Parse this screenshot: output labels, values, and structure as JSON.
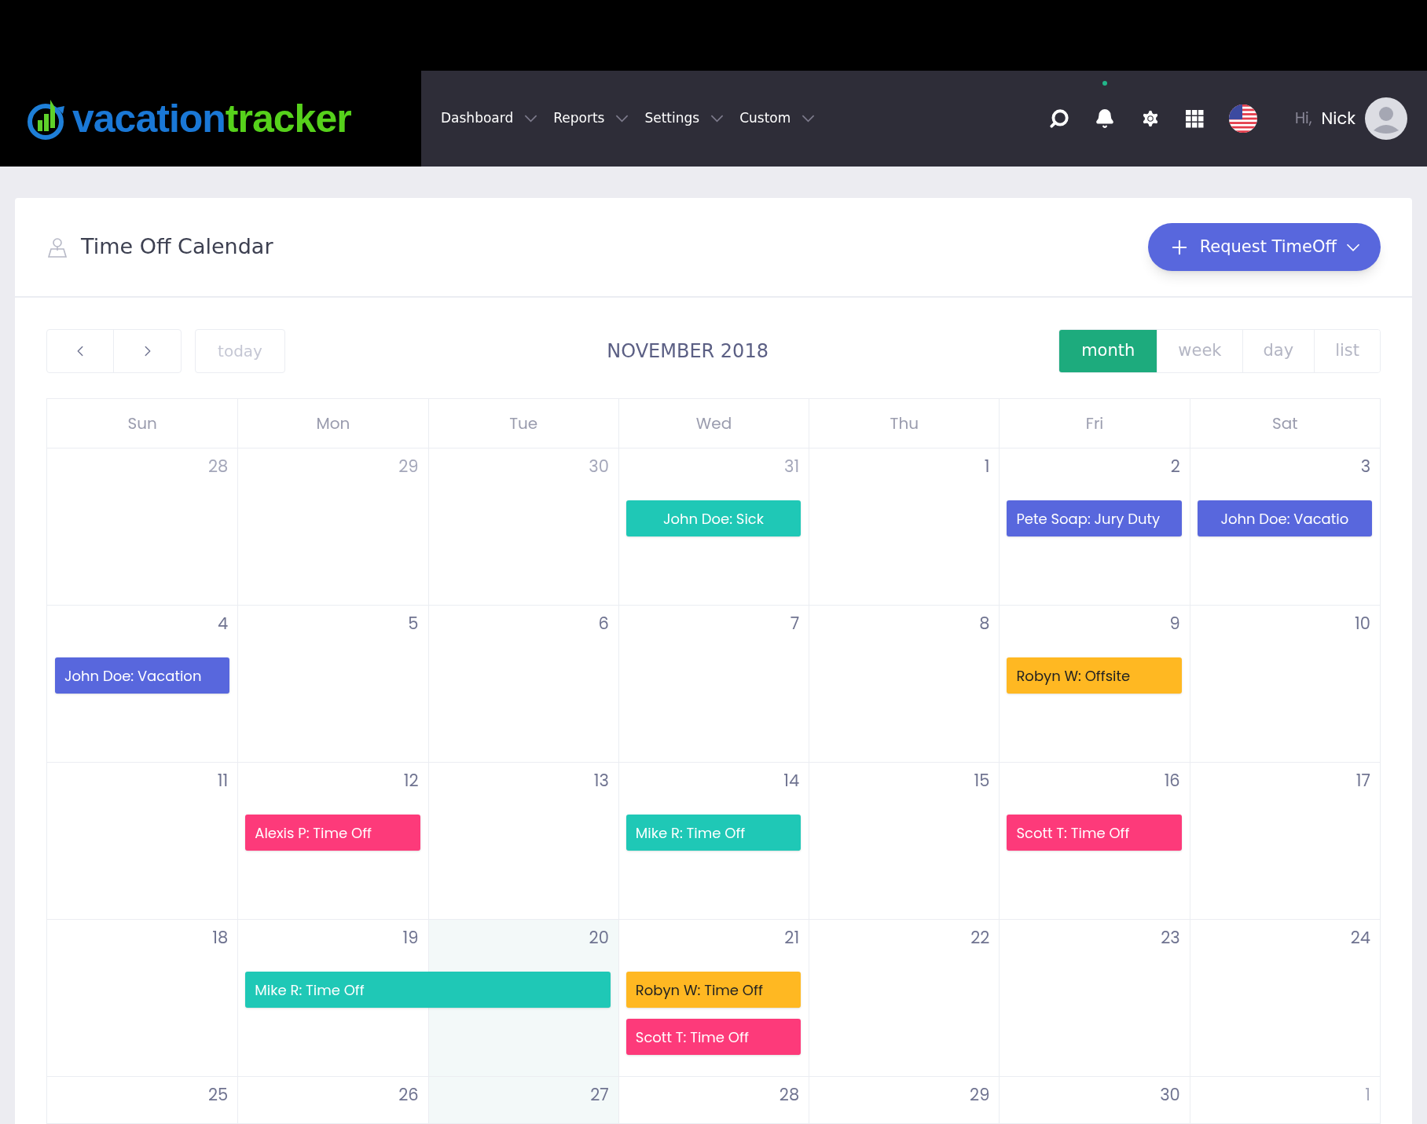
{
  "logo": {
    "parts": [
      "vacation",
      "tracker"
    ]
  },
  "nav": [
    {
      "label": "Dashboard"
    },
    {
      "label": "Reports"
    },
    {
      "label": "Settings"
    },
    {
      "label": "Custom"
    }
  ],
  "notifications": {
    "unread": true
  },
  "user": {
    "greeting": "Hi,",
    "name": "Nick"
  },
  "page": {
    "title": "Time Off Calendar",
    "request_button": "Request TimeOff"
  },
  "toolbar": {
    "today": "today",
    "title": "NOVEMBER 2018",
    "views": [
      {
        "label": "month",
        "selected": true
      },
      {
        "label": "week",
        "selected": false
      },
      {
        "label": "day",
        "selected": false
      },
      {
        "label": "list",
        "selected": false
      }
    ]
  },
  "weekdays": [
    "Sun",
    "Mon",
    "Tue",
    "Wed",
    "Thu",
    "Fri",
    "Sat"
  ],
  "weeks": [
    {
      "days": [
        {
          "date": "28",
          "muted": true
        },
        {
          "date": "29",
          "muted": true
        },
        {
          "date": "30",
          "muted": true
        },
        {
          "date": "31",
          "muted": true,
          "events": [
            {
              "title": "John Doe: Sick",
              "color": "#1fc8b6",
              "centered": true
            }
          ]
        },
        {
          "date": "1",
          "muted": false
        },
        {
          "date": "2",
          "muted": false,
          "events": [
            {
              "title": "Pete Soap: Jury Duty",
              "color": "#5867dd"
            }
          ]
        },
        {
          "date": "3",
          "muted": false,
          "events": [
            {
              "title": "John Doe: Vacatio",
              "color": "#5867dd",
              "centered": true
            }
          ]
        }
      ]
    },
    {
      "days": [
        {
          "date": "4",
          "muted": false,
          "events": [
            {
              "title": "John Doe: Vacation",
              "color": "#5867dd"
            }
          ]
        },
        {
          "date": "5",
          "muted": false
        },
        {
          "date": "6",
          "muted": false
        },
        {
          "date": "7",
          "muted": false
        },
        {
          "date": "8",
          "muted": false
        },
        {
          "date": "9",
          "muted": false,
          "events": [
            {
              "title": "Robyn W: Offsite",
              "color": "#ffb822"
            }
          ]
        },
        {
          "date": "10",
          "muted": false
        }
      ]
    },
    {
      "days": [
        {
          "date": "11",
          "muted": false
        },
        {
          "date": "12",
          "muted": false,
          "events": [
            {
              "title": "Alexis P: Time Off",
              "color": "#fd3a7a"
            }
          ]
        },
        {
          "date": "13",
          "muted": false
        },
        {
          "date": "14",
          "muted": false,
          "events": [
            {
              "title": "Mike R: Time Off",
              "color": "#1fc8b6"
            }
          ]
        },
        {
          "date": "15",
          "muted": false
        },
        {
          "date": "16",
          "muted": false,
          "events": [
            {
              "title": "Scott T: Time Off",
              "color": "#fd3a7a"
            }
          ]
        },
        {
          "date": "17",
          "muted": false
        }
      ]
    },
    {
      "days": [
        {
          "date": "18",
          "muted": false
        },
        {
          "date": "19",
          "muted": false,
          "events": [
            {
              "title": "Mike R: Time Off",
              "color": "#1fc8b6",
              "continues": true
            }
          ]
        },
        {
          "date": "20",
          "muted": false,
          "highlighted": true
        },
        {
          "date": "21",
          "muted": false,
          "events": [
            {
              "title": "Robyn W: Time Off",
              "color": "#ffb822"
            },
            {
              "title": "Scott T: Time Off",
              "color": "#fd3a7a"
            }
          ]
        },
        {
          "date": "22",
          "muted": false
        },
        {
          "date": "23",
          "muted": false
        },
        {
          "date": "24",
          "muted": false
        }
      ]
    },
    {
      "days": [
        {
          "date": "25",
          "muted": false
        },
        {
          "date": "26",
          "muted": false
        },
        {
          "date": "27",
          "muted": false,
          "highlighted": true
        },
        {
          "date": "28",
          "muted": false
        },
        {
          "date": "29",
          "muted": false
        },
        {
          "date": "30",
          "muted": false
        },
        {
          "date": "1",
          "muted": true
        }
      ]
    }
  ]
}
